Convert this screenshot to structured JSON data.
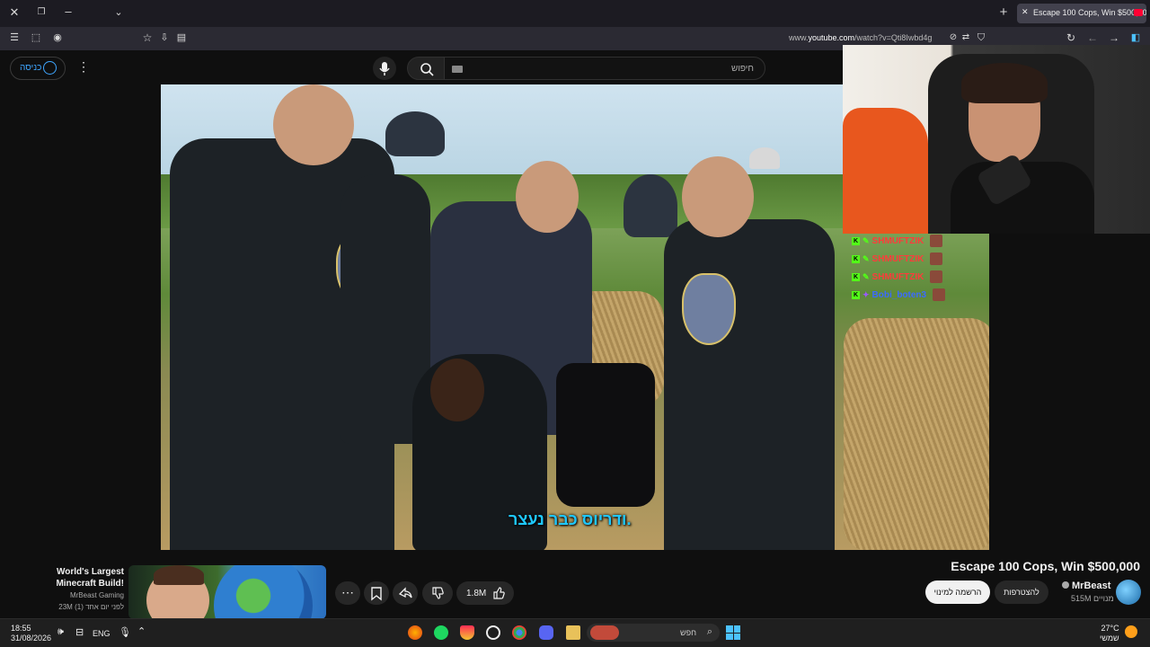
{
  "browser": {
    "active_tab_title": "Escape 100 Cops, Win $500,000",
    "url_prefix": "www.",
    "url_domain": "youtube.com",
    "url_path": "/watch?v=Qti8Iwbd4g"
  },
  "youtube": {
    "signin_label": "כניסה",
    "search_placeholder": "חיפוש"
  },
  "video": {
    "subtitle": "ודריוס כבר נעצר.",
    "title": "Escape 100 Cops, Win $500,000",
    "channel_name": "MrBeast",
    "subscribers": "515M מנויים",
    "subscribe_label": "הרשמה למינוי",
    "join_label": "להצטרפות",
    "like_count": "1.8M"
  },
  "chat": {
    "messages": [
      {
        "user": "SHMUFTZIK",
        "color": "#ff3b3b"
      },
      {
        "user": "SHMUFTZIK",
        "color": "#ff3b3b"
      },
      {
        "user": "SHMUFTZIK",
        "color": "#ff3b3b"
      },
      {
        "user": "Bobi_boten3",
        "color": "#3b6bff"
      }
    ]
  },
  "recommendation": {
    "title": "World's Largest Minecraft Build!",
    "channel": "MrBeast Gaming",
    "meta": "23M  לפני יום אחד (1)"
  },
  "taskbar": {
    "time": "18:55",
    "date": "31/08/2026",
    "language": "ENG",
    "search_placeholder": "חפש",
    "temperature": "27°C",
    "weather_text": "שמשי"
  }
}
